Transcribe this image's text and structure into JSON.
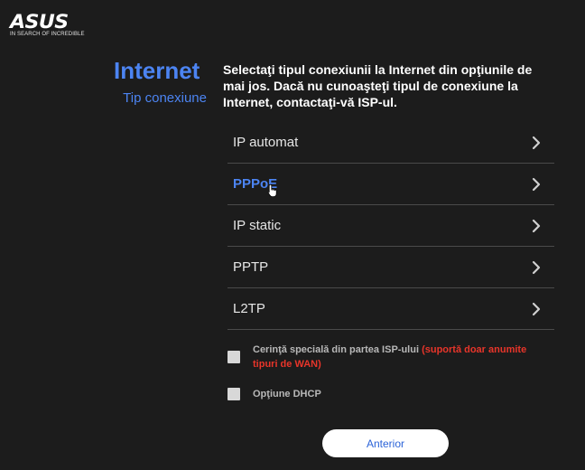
{
  "brand": {
    "logo_text": "ASUS",
    "tagline": "IN SEARCH OF INCREDIBLE"
  },
  "header": {
    "title": "Internet",
    "subtitle": "Tip conexiune"
  },
  "description": "Selectaţi tipul conexiunii la Internet din opţiunile de mai jos. Dacă nu cunoaşteţi tipul de conexiune la Internet, contactaţi-vă ISP-ul.",
  "connection_types": [
    {
      "label": "IP automat",
      "active": false
    },
    {
      "label": "PPPoE",
      "active": true
    },
    {
      "label": "IP static",
      "active": false
    },
    {
      "label": "PPTP",
      "active": false
    },
    {
      "label": "L2TP",
      "active": false
    }
  ],
  "options": {
    "isp_special": {
      "label": "Cerinţă specială din partea ISP-ului",
      "warning": "(suportă doar anumite tipuri de WAN)",
      "checked": false
    },
    "dhcp": {
      "label": "Opţiune DHCP",
      "checked": false
    }
  },
  "buttons": {
    "back_label": "Anterior"
  },
  "colors": {
    "background": "#1c1c1c",
    "accent": "#4c84f2",
    "warning": "#e8352a",
    "divider": "#4a4a4a"
  }
}
